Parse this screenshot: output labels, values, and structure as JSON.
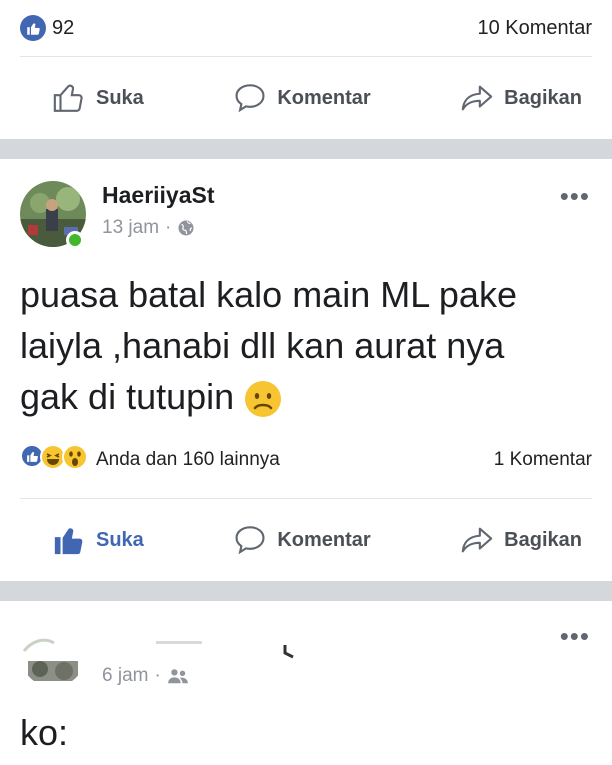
{
  "top_post": {
    "like_count": "92",
    "comment_count": "10 Komentar",
    "actions": {
      "like": "Suka",
      "comment": "Komentar",
      "share": "Bagikan"
    }
  },
  "post": {
    "author": "HaeriiyaSt",
    "time": "13 jam",
    "dot": "·",
    "text_lines": [
      "puasa batal kalo main ML pake",
      "laiyla ,hanabi dll kan aurat nya",
      "gak di tutupin"
    ],
    "reactions_text": "Anda dan 160 lainnya",
    "comment_count": "1 Komentar",
    "actions": {
      "like": "Suka",
      "comment": "Komentar",
      "share": "Bagikan"
    },
    "like_active_color": "#4267b2"
  },
  "next_post": {
    "time": "6 jam",
    "dot": "·",
    "text_partial": "ko:"
  },
  "icons": {
    "like_badge": "thumbs-up-icon",
    "globe": "globe-icon",
    "friends": "friends-icon",
    "more": "more-icon"
  },
  "colors": {
    "facebook_blue": "#4267b2",
    "online_green": "#42b72a",
    "meta_gray": "#90949c",
    "separator": "#d4d8dd"
  }
}
